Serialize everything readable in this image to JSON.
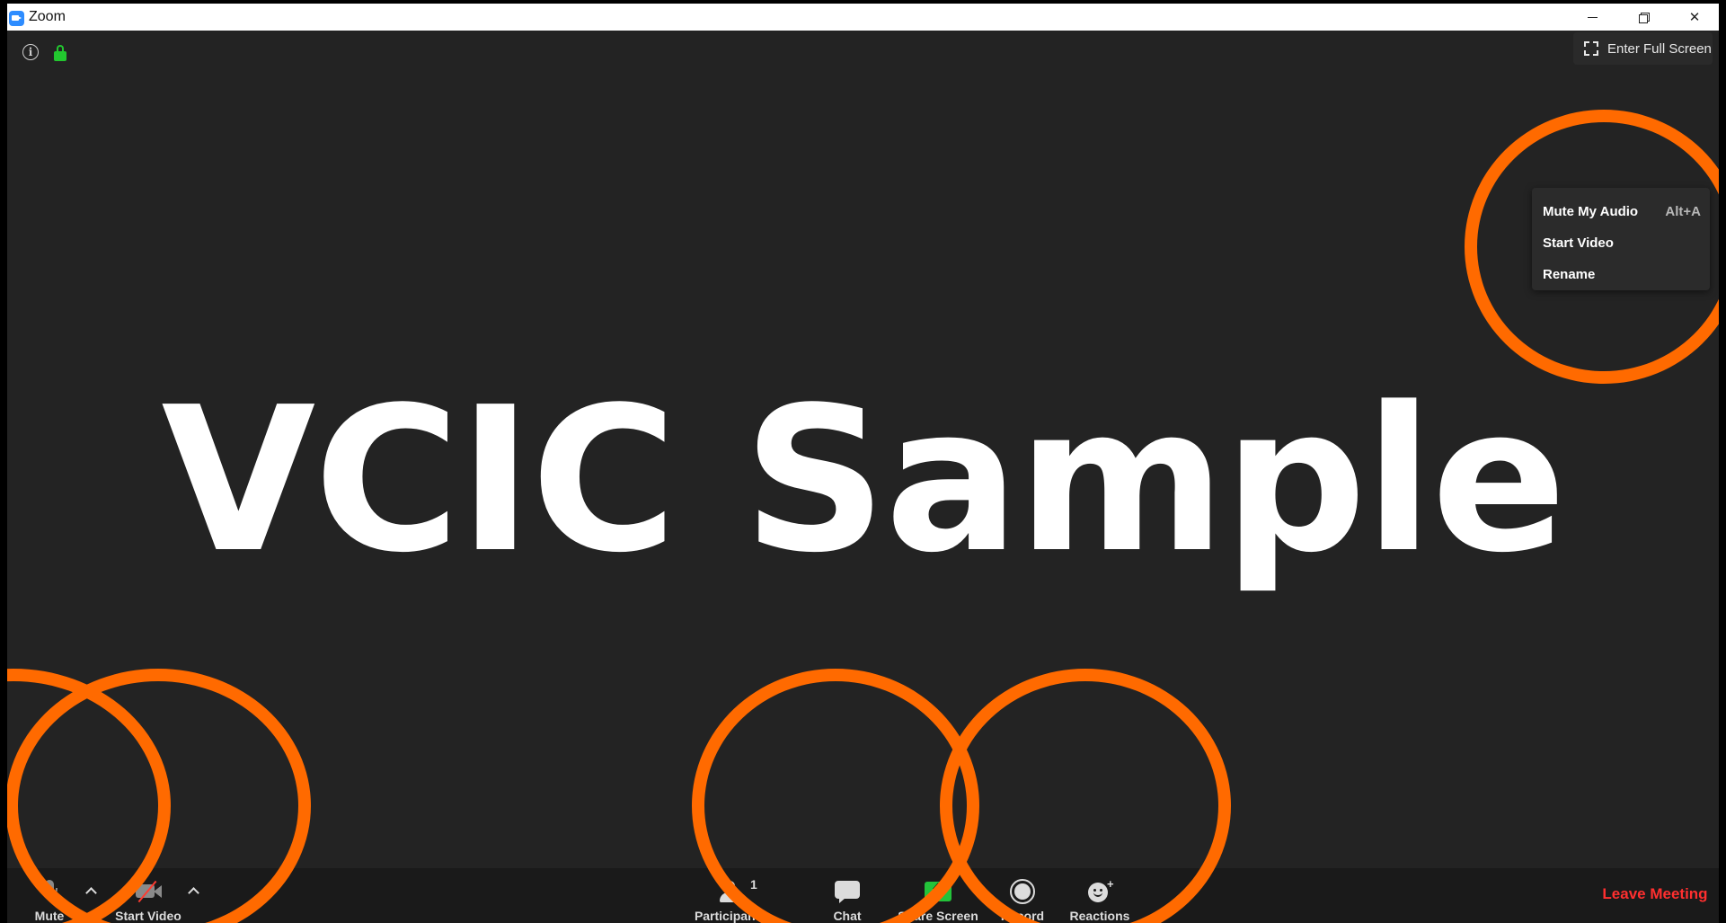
{
  "window": {
    "title": "Zoom",
    "minimize_icon": "minimize-icon",
    "restore_icon": "restore-icon",
    "close_symbol": "✕"
  },
  "top_bar": {
    "info_glyph": "i",
    "fullscreen_label": "Enter Full Screen"
  },
  "context_menu": {
    "items": [
      {
        "label": "Mute My Audio",
        "shortcut": "Alt+A"
      },
      {
        "label": "Start Video",
        "shortcut": ""
      },
      {
        "label": "Rename",
        "shortcut": ""
      }
    ]
  },
  "participant": {
    "display_name": "VCIC Sample"
  },
  "toolbar": {
    "mute_label": "Mute",
    "start_video_label": "Start Video",
    "participants_label": "Participants",
    "participants_count": "1",
    "chat_label": "Chat",
    "share_screen_label": "Share Screen",
    "record_label": "Record",
    "reactions_label": "Reactions",
    "reactions_plus": "+",
    "leave_label": "Leave Meeting"
  },
  "colors": {
    "background": "#232323",
    "toolbar": "#1a1a1a",
    "share_green": "#23c33a",
    "leave_red": "#ff2f2f",
    "lock_green": "#22c72f",
    "annotation_orange": "#ff6a00"
  }
}
